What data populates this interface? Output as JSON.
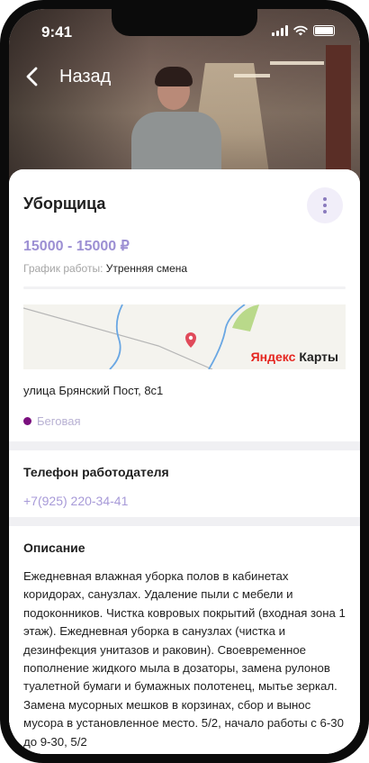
{
  "status_bar": {
    "time": "9:41"
  },
  "nav": {
    "back_label": "Назад"
  },
  "job": {
    "title": "Уборщица",
    "salary": "15000 - 15000 ₽",
    "schedule_label": "График работы:",
    "schedule_value": "Утренняя смена"
  },
  "location": {
    "map_logo_part1": "Яндекс",
    "map_logo_part2": "Карты",
    "address": "улица Брянский Пост, 8с1",
    "metro": "Беговая",
    "metro_color": "#7a0f7e"
  },
  "phone": {
    "title": "Телефон работодателя",
    "value": "+7(925) 220-34-41"
  },
  "description": {
    "title": "Описание",
    "text": "Ежедневная влажная уборка полов в кабинетах коридорах, санузлах. Удаление пыли с мебели и подоконников. Чистка ковровых покрытий (входная зона 1 этаж). Ежедневная уборка в санузлах (чистка и дезинфекция унитазов и раковин). Своевременное пополнение жидкого мыла в дозаторы, замена рулонов туалетной бумаги и бумажных полотенец, мытье зеркал. Замена мусорных мешков в корзинах, сбор и вынос мусора в установленное место. 5/2, начало работы с 6-30 до 9-30, 5/2"
  },
  "colors": {
    "accent": "#9c8fd3",
    "phone_link": "#a79ad8"
  }
}
